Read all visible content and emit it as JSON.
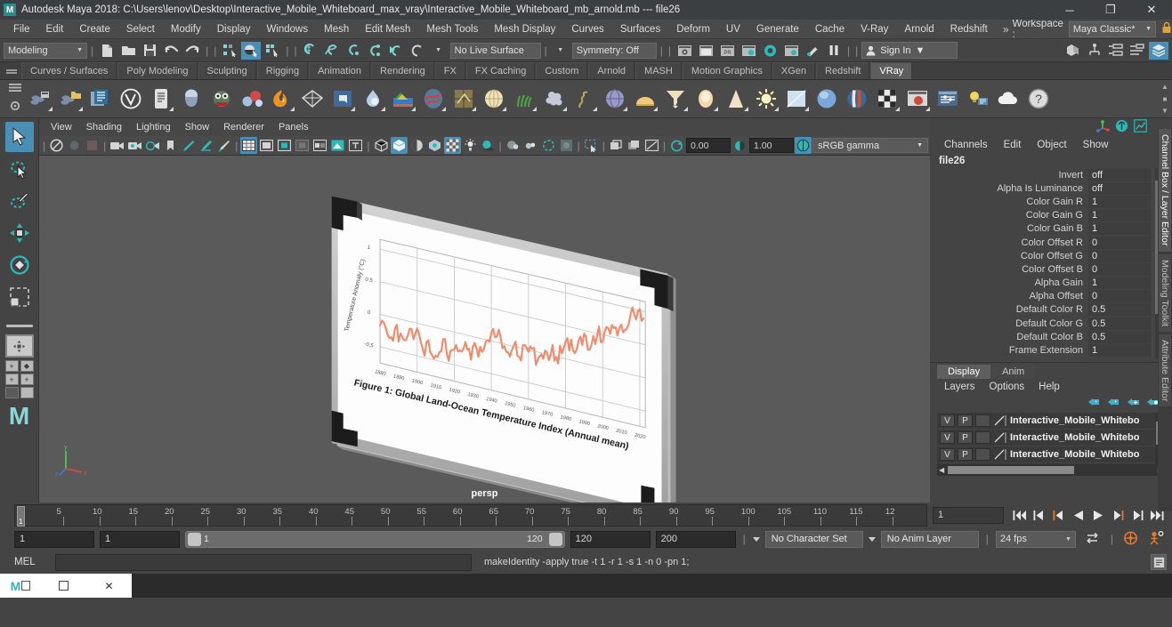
{
  "window": {
    "app_icon": "maya-logo",
    "title": "Autodesk Maya 2018: C:\\Users\\lenov\\Desktop\\Interactive_Mobile_Whiteboard_max_vray\\Interactive_Mobile_Whiteboard_mb_arnold.mb  ---  file26",
    "minimize": "─",
    "maximize": "❐",
    "close": "✕"
  },
  "menubar": {
    "items": [
      "File",
      "Edit",
      "Create",
      "Select",
      "Modify",
      "Display",
      "Windows",
      "Mesh",
      "Edit Mesh",
      "Mesh Tools",
      "Mesh Display",
      "Curves",
      "Surfaces",
      "Deform",
      "UV",
      "Generate",
      "Cache",
      "V-Ray",
      "Arnold",
      "Redshift"
    ],
    "workspace_chevron": "»",
    "workspace_label": "Workspace :",
    "workspace_value": "Maya Classic*",
    "lock_icon": "lock-icon"
  },
  "statusline": {
    "menu_set": "Modeling",
    "no_live_surface": "No Live Surface",
    "symmetry": "Symmetry: Off",
    "numeric_left": "0.00",
    "numeric_right": "1.00",
    "sign_in": "Sign In"
  },
  "shelf": {
    "tabs": [
      "Curves / Surfaces",
      "Poly Modeling",
      "Sculpting",
      "Rigging",
      "Animation",
      "Rendering",
      "FX",
      "FX Caching",
      "Custom",
      "Arnold",
      "MASH",
      "Motion Graphics",
      "XGen",
      "Redshift",
      "VRay"
    ],
    "active_tab": "VRay",
    "icons": [
      "vray-render-icon",
      "vray-render-last-icon",
      "vray-frame-buffer-icon",
      "vray-logo-icon",
      "vray-attributes-icon",
      "vray-material-icon",
      "vray-toon-icon",
      "vray-molecule-icon",
      "vray-fire-icon",
      "vray-mesh-light-icon",
      "vray-dome-light-icon",
      "vray-fog-icon",
      "vray-displacement-icon",
      "vray-heightmap-icon",
      "vray-sphere-fade-icon",
      "vray-plane-icon",
      "vray-sun-sky-icon",
      "vray-grass-icon",
      "vray-scatter-icon",
      "vray-proxy-icon",
      "vray-curve-icon",
      "vray-sphere-light-icon",
      "vray-dome-icon",
      "vray-ies-light-icon",
      "vray-sphere-gradient-icon",
      "vray-cone-light-icon",
      "vray-sun-icon",
      "vray-rect-light-icon",
      "vray-ball-icon",
      "vray-stripe-icon",
      "vray-checker-icon",
      "vray-preview-icon",
      "vray-settings-icon",
      "vray-light-lister-icon",
      "vray-cloud-icon",
      "vray-help-icon"
    ]
  },
  "toolbox": {
    "tools": [
      "select-tool",
      "lasso-select-tool",
      "paint-select-tool",
      "move-tool",
      "rotate-tool",
      "scale-tool"
    ],
    "active_tool": "select-tool",
    "layout_presets": [
      "single-perspective-layout",
      "four-view-layout",
      "two-pane-layout"
    ]
  },
  "viewport": {
    "menus": [
      "View",
      "Shading",
      "Lighting",
      "Show",
      "Renderer",
      "Panels"
    ],
    "exposure": "0.00",
    "gamma": "1.00",
    "color_profile": "sRGB gamma",
    "camera_label": "persp",
    "axis_labels": {
      "x": "x",
      "y": "y",
      "z": "z"
    }
  },
  "chart_data": {
    "type": "line",
    "title": "Figure 1: Global Land-Ocean Temperature Index (Annual mean)",
    "xlabel": "",
    "ylabel": "Temperature Anomaly (°C)",
    "line_color": "#f08a6a",
    "grid": true,
    "legend": "none",
    "xlim": [
      1880,
      2023
    ],
    "ylim": [
      -0.75,
      1.15
    ],
    "xticks": [
      1880,
      1890,
      1900,
      1910,
      1920,
      1930,
      1940,
      1950,
      1960,
      1970,
      1980,
      1990,
      2000,
      2010,
      2020
    ],
    "yticks": [
      -0.5,
      0,
      0.5,
      1
    ],
    "x": [
      1880,
      1881,
      1882,
      1883,
      1884,
      1885,
      1886,
      1887,
      1888,
      1889,
      1890,
      1891,
      1892,
      1893,
      1894,
      1895,
      1896,
      1897,
      1898,
      1899,
      1900,
      1901,
      1902,
      1903,
      1904,
      1905,
      1906,
      1907,
      1908,
      1909,
      1910,
      1911,
      1912,
      1913,
      1914,
      1915,
      1916,
      1917,
      1918,
      1919,
      1920,
      1921,
      1922,
      1923,
      1924,
      1925,
      1926,
      1927,
      1928,
      1929,
      1930,
      1931,
      1932,
      1933,
      1934,
      1935,
      1936,
      1937,
      1938,
      1939,
      1940,
      1941,
      1942,
      1943,
      1944,
      1945,
      1946,
      1947,
      1948,
      1949,
      1950,
      1951,
      1952,
      1953,
      1954,
      1955,
      1956,
      1957,
      1958,
      1959,
      1960,
      1961,
      1962,
      1963,
      1964,
      1965,
      1966,
      1967,
      1968,
      1969,
      1970,
      1971,
      1972,
      1973,
      1974,
      1975,
      1976,
      1977,
      1978,
      1979,
      1980,
      1981,
      1982,
      1983,
      1984,
      1985,
      1986,
      1987,
      1988,
      1989,
      1990,
      1991,
      1992,
      1993,
      1994,
      1995,
      1996,
      1997,
      1998,
      1999,
      2000,
      2001,
      2002,
      2003,
      2004,
      2005,
      2006,
      2007,
      2008,
      2009,
      2010,
      2011,
      2012,
      2013,
      2014,
      2015,
      2016,
      2017,
      2018,
      2019,
      2020,
      2021,
      2022
    ],
    "values": [
      -0.17,
      -0.09,
      -0.11,
      -0.18,
      -0.28,
      -0.33,
      -0.31,
      -0.36,
      -0.17,
      -0.1,
      -0.35,
      -0.22,
      -0.27,
      -0.31,
      -0.3,
      -0.22,
      -0.11,
      -0.11,
      -0.26,
      -0.17,
      -0.08,
      -0.15,
      -0.28,
      -0.37,
      -0.47,
      -0.26,
      -0.22,
      -0.39,
      -0.43,
      -0.48,
      -0.43,
      -0.44,
      -0.36,
      -0.34,
      -0.15,
      -0.14,
      -0.36,
      -0.46,
      -0.3,
      -0.28,
      -0.27,
      -0.19,
      -0.28,
      -0.26,
      -0.27,
      -0.22,
      -0.11,
      -0.22,
      -0.2,
      -0.36,
      -0.16,
      -0.09,
      -0.16,
      -0.29,
      -0.13,
      -0.2,
      -0.15,
      -0.03,
      0.0,
      -0.02,
      0.13,
      0.19,
      0.07,
      0.09,
      0.2,
      0.09,
      -0.07,
      -0.03,
      -0.11,
      -0.11,
      -0.17,
      -0.07,
      0.01,
      0.08,
      -0.13,
      -0.14,
      -0.19,
      0.05,
      0.06,
      0.03,
      -0.03,
      0.06,
      0.03,
      0.05,
      -0.2,
      -0.11,
      -0.06,
      -0.02,
      -0.08,
      0.05,
      0.03,
      -0.08,
      0.01,
      0.16,
      -0.07,
      -0.01,
      -0.1,
      0.18,
      0.07,
      0.16,
      0.26,
      0.32,
      0.14,
      0.31,
      0.16,
      0.12,
      0.18,
      0.32,
      0.39,
      0.27,
      0.45,
      0.41,
      0.22,
      0.23,
      0.31,
      0.45,
      0.33,
      0.46,
      0.61,
      0.38,
      0.39,
      0.54,
      0.63,
      0.62,
      0.54,
      0.68,
      0.64,
      0.66,
      0.54,
      0.66,
      0.72,
      0.61,
      0.65,
      0.68,
      0.75,
      0.9,
      1.02,
      0.92,
      0.85,
      0.98,
      1.02,
      0.85,
      0.89
    ]
  },
  "channelbox": {
    "corner_icons": [
      "show-manipulators-icon",
      "channel-box-icon",
      "graph-editor-icon"
    ],
    "menus": [
      "Channels",
      "Edit",
      "Object",
      "Show"
    ],
    "node_name": "file26",
    "attributes": [
      {
        "label": "Invert",
        "value": "off"
      },
      {
        "label": "Alpha Is Luminance",
        "value": "off"
      },
      {
        "label": "Color Gain R",
        "value": "1"
      },
      {
        "label": "Color Gain G",
        "value": "1"
      },
      {
        "label": "Color Gain B",
        "value": "1"
      },
      {
        "label": "Color Offset R",
        "value": "0"
      },
      {
        "label": "Color Offset G",
        "value": "0"
      },
      {
        "label": "Color Offset B",
        "value": "0"
      },
      {
        "label": "Alpha Gain",
        "value": "1"
      },
      {
        "label": "Alpha Offset",
        "value": "0"
      },
      {
        "label": "Default Color R",
        "value": "0.5"
      },
      {
        "label": "Default Color G",
        "value": "0.5"
      },
      {
        "label": "Default Color B",
        "value": "0.5"
      },
      {
        "label": "Frame Extension",
        "value": "1"
      }
    ]
  },
  "layereditor": {
    "tabs": [
      "Display",
      "Anim"
    ],
    "active_tab": "Display",
    "menus": [
      "Layers",
      "Options",
      "Help"
    ],
    "buttons": [
      "move-layer-up-icon",
      "move-layer-down-icon",
      "new-layer-icon",
      "new-layer-from-selected-icon"
    ],
    "rows": [
      {
        "visibility": "V",
        "playback": "P",
        "shading": "",
        "name": "Interactive_Mobile_Whitebo"
      },
      {
        "visibility": "V",
        "playback": "P",
        "shading": "",
        "name": "Interactive_Mobile_Whitebo"
      },
      {
        "visibility": "V",
        "playback": "P",
        "shading": "",
        "name": "Interactive_Mobile_Whitebo"
      }
    ]
  },
  "sidetabs": [
    {
      "label": "Channel Box / Layer Editor",
      "active": true
    },
    {
      "label": "Modeling Toolkit",
      "active": false
    },
    {
      "label": "Attribute Editor",
      "active": false
    }
  ],
  "timeslider": {
    "ticks": [
      "5",
      "10",
      "15",
      "20",
      "25",
      "30",
      "35",
      "40",
      "45",
      "50",
      "55",
      "60",
      "65",
      "70",
      "75",
      "80",
      "85",
      "90",
      "95",
      "100",
      "105",
      "110",
      "115",
      "12"
    ],
    "current_frame_marker": "1",
    "current_frame_field": "1",
    "playback_buttons": [
      "go-to-start-icon",
      "step-back-keyframe-icon",
      "step-back-frame-icon",
      "play-backwards-icon",
      "play-forwards-icon",
      "step-forward-frame-icon",
      "step-forward-keyframe-icon",
      "go-to-end-icon"
    ]
  },
  "rangeslider": {
    "anim_start": "1",
    "range_start": "1",
    "bar_start": "1",
    "bar_end": "120",
    "range_end": "120",
    "anim_end": "200",
    "character_set": "No Character Set",
    "anim_layer": "No Anim Layer",
    "fps": "24 fps",
    "auto_key_icon": "auto-keyframe-icon",
    "anim_prefs_icon": "animation-preferences-icon",
    "cycle_icon": "playback-loop-icon"
  },
  "commandline": {
    "mel_label": "MEL",
    "input_value": "",
    "output": "makeIdentity -apply true -t 1 -r 1 -s 1 -n 0 -pn 1;",
    "script_editor_icon": "script-editor-icon"
  },
  "taskbar": {
    "items": [
      "maya-taskbar-icon",
      "restore-window-icon",
      "close-window-icon"
    ]
  },
  "colors": {
    "accent": "#4a8fb5",
    "chart_line": "#f08a6a",
    "panel_bg": "#444444",
    "viewport_bg": "#5a5a5a",
    "teal": "#2eb8b8"
  }
}
